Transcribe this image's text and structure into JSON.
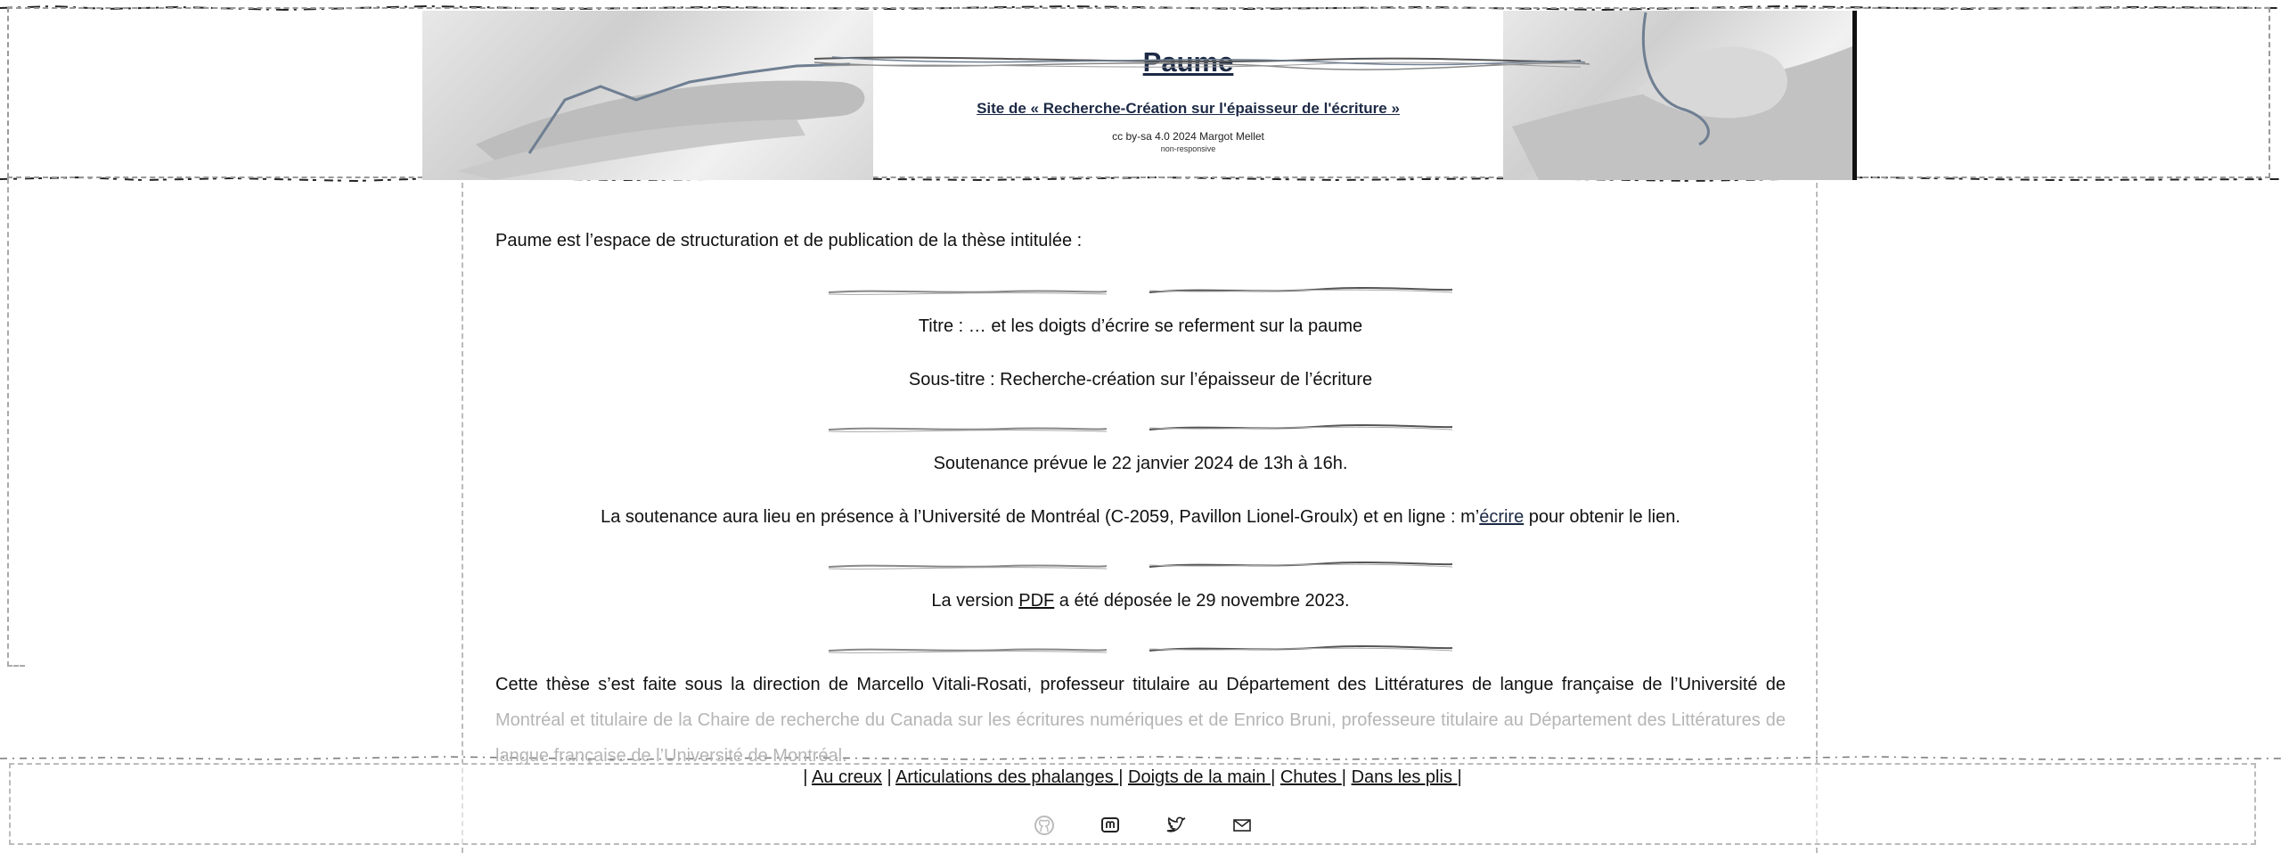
{
  "header": {
    "title": "Paume",
    "subtitle": "Site de « Recherche-Création sur l'épaisseur de l'écriture »",
    "license": "cc by-sa 4.0 2024 Margot Mellet",
    "note": "non-responsive"
  },
  "main": {
    "intro": "Paume est l’espace de structuration et de publication de la thèse intitulée :",
    "titre": "Titre : … et les doigts d’écrire se referment sur la paume",
    "sous_titre": "Sous-titre : Recherche-création sur l’épaisseur de l’écriture",
    "soutenance": "Soutenance prévue le 22 janvier 2024 de 13h à 16h.",
    "lieu_before": "La soutenance aura lieu en présence à l’Université de Montréal (C-2059, Pavillon Lionel-Groulx) et en ligne : m’",
    "lieu_link": "écrire",
    "lieu_after": " pour obtenir le lien.",
    "version_before": "La version ",
    "version_link": "PDF",
    "version_after": " a été déposée le 29 novembre 2023.",
    "direction_visible": "Cette thèse s’est faite sous la direction de Marcello Vitali-Rosati, professeur titulaire au Département des Littératures de langue française de l’Université de",
    "direction_faded": "Montréal et titulaire de la Chaire de recherche du Canada sur les écritures numériques et de Enrico Bruni, professeure titulaire au Département des Littératures de langue française de l’Université de Montréal."
  },
  "footer": {
    "nav": [
      {
        "label": "Au creux"
      },
      {
        "label": "Articulations des phalanges "
      },
      {
        "label": "Doigts de la main "
      },
      {
        "label": "Chutes "
      },
      {
        "label": "Dans les plis "
      }
    ],
    "separator": "|",
    "icons": [
      "github-icon",
      "mastodon-icon",
      "twitter-icon",
      "mail-icon"
    ]
  },
  "colors": {
    "accent": "#1d2a45",
    "text": "#111111",
    "faded": "#b5b5b5"
  }
}
